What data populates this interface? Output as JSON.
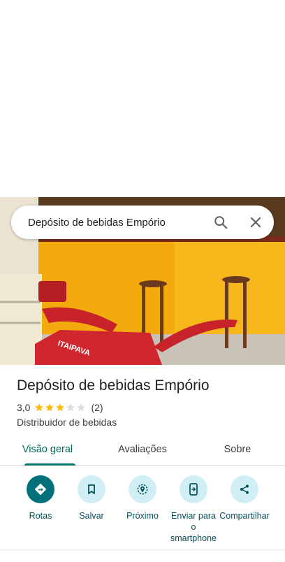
{
  "search": {
    "query": "Depósito de bebidas Empório",
    "search_icon": "search-icon",
    "close_icon": "close-icon"
  },
  "photo": {
    "description_icon": "place-photo",
    "sign_text": "ITAIPAVA"
  },
  "place": {
    "title": "Depósito de bebidas Empório",
    "rating": "3,0",
    "rating_value": 3,
    "max_rating": 5,
    "review_count": "(2)",
    "category": "Distribuidor de bebidas"
  },
  "tabs": [
    {
      "label": "Visão geral",
      "active": true
    },
    {
      "label": "Avaliações",
      "active": false
    },
    {
      "label": "Sobre",
      "active": false
    }
  ],
  "actions": [
    {
      "label": "Rotas",
      "icon": "directions-icon"
    },
    {
      "label": "Salvar",
      "icon": "bookmark-icon"
    },
    {
      "label": "Próximo",
      "icon": "nearby-icon"
    },
    {
      "label": "Enviar para o smartphone",
      "icon": "send-to-phone-icon"
    },
    {
      "label": "Compartilhar",
      "icon": "share-icon"
    }
  ],
  "colors": {
    "accent": "#00796b",
    "action_bg": "#cfeff5",
    "action_primary": "#00707a",
    "star": "#fbbc04"
  }
}
